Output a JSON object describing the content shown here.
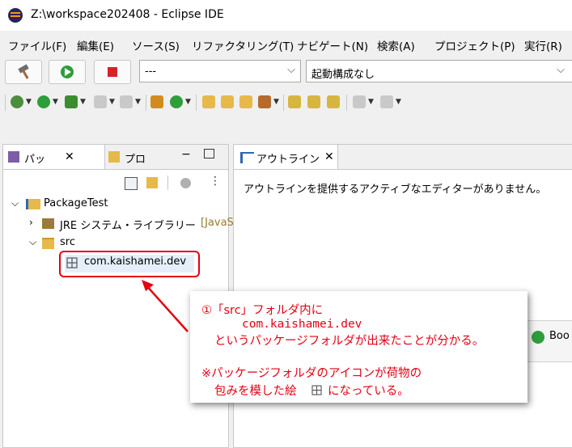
{
  "window": {
    "title": "Z:\\workspace202408 - Eclipse IDE"
  },
  "menu": {
    "items": [
      "ファイル(F)",
      "編集(E)",
      "ソース(S)",
      "リファクタリング(T)",
      "ナビゲート(N)",
      "検索(A)",
      "プロジェクト(P)",
      "実行(R)"
    ]
  },
  "toolbar": {
    "run_config_value": "---",
    "launch_config_value": "起動構成なし"
  },
  "left_view": {
    "tabs": [
      {
        "label": "パッ",
        "icon": "package-explorer-icon"
      },
      {
        "label": "プロ",
        "icon": "project-explorer-icon"
      }
    ],
    "tree": [
      {
        "label": "PackageTest",
        "expanded": true,
        "icon": "java-project-icon"
      },
      {
        "label": "JRE システム・ライブラリー",
        "suffix": "[JavaS",
        "expanded": false,
        "icon": "library-icon"
      },
      {
        "label": "src",
        "expanded": true,
        "icon": "source-folder-icon"
      },
      {
        "label": "com.kaishamei.dev",
        "icon": "package-icon"
      }
    ]
  },
  "right_view": {
    "tab_label": "アウトライン",
    "message": "アウトラインを提供するアクティブなエディターがありません。",
    "bottom_partial_label": "Boo"
  },
  "callout": {
    "line1": "①「src」フォルダ内に",
    "line2": "com.kaishamei.dev",
    "line3": "というパッケージフォルダが出来たことが分かる。",
    "line4": "※パッケージフォルダのアイコンが荷物の",
    "line5": "包みを模した絵",
    "line6": "になっている。",
    "color": "#e60012"
  }
}
